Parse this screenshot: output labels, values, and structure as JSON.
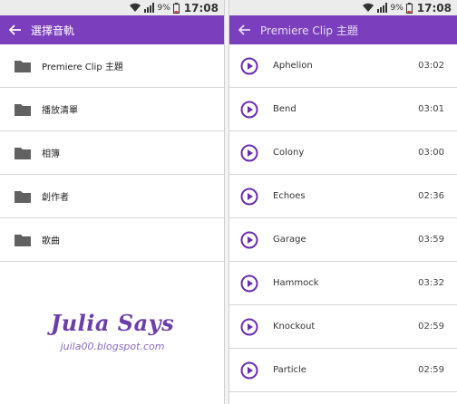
{
  "status": {
    "battery_pct": "9%",
    "time": "17:08"
  },
  "left": {
    "title": "選擇音軌",
    "items": [
      {
        "label": "Premiere Clip 主題"
      },
      {
        "label": "播放清單"
      },
      {
        "label": "相簿"
      },
      {
        "label": "創作者"
      },
      {
        "label": "歌曲"
      }
    ]
  },
  "right": {
    "title": "Premiere Clip 主題",
    "tracks": [
      {
        "name": "Aphelion",
        "duration": "03:02"
      },
      {
        "name": "Bend",
        "duration": "03:01"
      },
      {
        "name": "Colony",
        "duration": "03:00"
      },
      {
        "name": "Echoes",
        "duration": "02:36"
      },
      {
        "name": "Garage",
        "duration": "03:59"
      },
      {
        "name": "Hammock",
        "duration": "03:32"
      },
      {
        "name": "Knockout",
        "duration": "02:59"
      },
      {
        "name": "Particle",
        "duration": "02:59"
      }
    ]
  },
  "watermark": {
    "title": "Julia Says",
    "url": "juila00.blogspot.com"
  },
  "colors": {
    "accent": "#7b3fbd",
    "play_icon": "#6a2fb0",
    "statusbar": "#ececec"
  },
  "icons": {
    "back": "arrow-left-icon",
    "folder": "folder-icon",
    "play": "play-circle-icon",
    "wifi": "wifi-icon",
    "signal": "signal-icon",
    "battery": "battery-icon"
  }
}
